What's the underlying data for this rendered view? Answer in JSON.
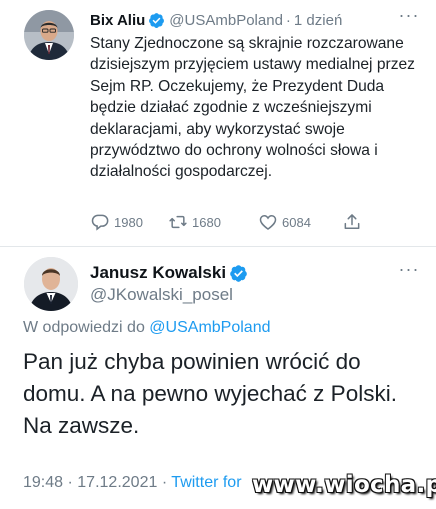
{
  "tweet1": {
    "author_name": "Bix Aliu",
    "author_handle": "@USAmbPoland",
    "separator": "·",
    "time_ago": "1 dzień",
    "more_label": "···",
    "text": "Stany Zjednoczone są skrajnie rozczarowane dzisiejszym przyjęciem ustawy medialnej przez Sejm RP. Oczekujemy, że Prezydent Duda będzie działać zgodnie z wcześniejszymi deklaracjami, aby wykorzystać swoje przywództwo do ochrony wolności słowa i działalności gospodarczej.",
    "replies": "1980",
    "retweets": "1680",
    "likes": "6084",
    "icons": [
      "verified-badge-icon",
      "reply-icon",
      "retweet-icon",
      "like-icon",
      "share-icon",
      "more-icon"
    ]
  },
  "tweet2": {
    "author_name": "Janusz Kowalski",
    "author_handle": "@JKowalski_posel",
    "more_label": "···",
    "replying_prefix": "W odpowiedzi do",
    "replying_to": "@USAmbPoland",
    "text": "Pan już chyba powinien wrócić do domu. A na pewno wyjechać z Polski. Na zawsze.",
    "time": "19:48",
    "dot1": "·",
    "date": "17.12.2021",
    "dot2": "·",
    "source": "Twitter for"
  },
  "watermark": "www.wiocha.pl",
  "colors": {
    "link": "#1d9bf0",
    "muted": "#6e7b87",
    "text": "#0f1419",
    "verified": "#1d9bf0",
    "divider": "#e3e7ea"
  }
}
